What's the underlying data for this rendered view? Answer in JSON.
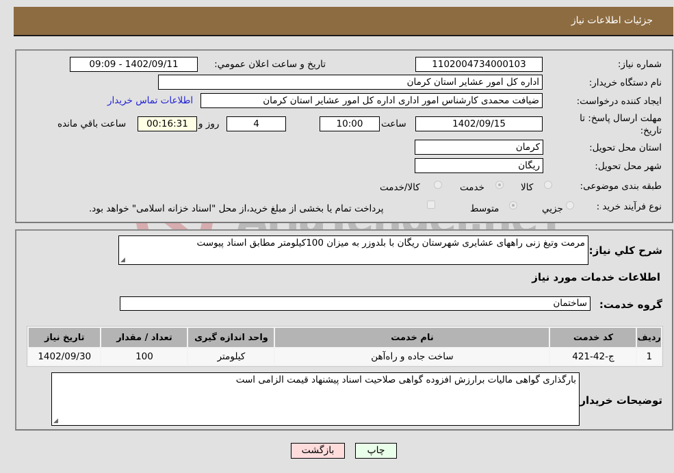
{
  "header": {
    "title": "جزئيات اطلاعات نياز"
  },
  "details": {
    "need_number_label": "شماره نياز:",
    "need_number": "1102004734000103",
    "announce_label": "تاريخ و ساعت اعلان عمومي:",
    "announce_value": "1402/09/11 - 09:09",
    "buyer_org_label": "نام دستگاه خريدار:",
    "buyer_org": "اداره کل امور عشاير استان کرمان",
    "creator_label": "ايجاد کننده درخواست:",
    "creator": "ضيافت محمدی کارشناس امور اداری اداره کل امور عشاير استان کرمان",
    "contact_link": "اطلاعات تماس خريدار",
    "deadline_label": "مهلت ارسال پاسخ: تا تاريخ:",
    "deadline_date": "1402/09/15",
    "time_label": "ساعت",
    "deadline_time": "10:00",
    "days_value": "4",
    "days_label": "روز و",
    "remaining_time": "00:16:31",
    "remaining_label": "ساعت باقي مانده",
    "province_label": "استان محل تحويل:",
    "province": "کرمان",
    "city_label": "شهر محل تحويل:",
    "city": "ريگان",
    "category_label": "طبقه بندی موضوعی:",
    "category_options": [
      {
        "label": "کالا",
        "selected": false
      },
      {
        "label": "خدمت",
        "selected": true
      },
      {
        "label": "کالا/خدمت",
        "selected": false
      }
    ],
    "process_label": "نوع فرآيند خريد :",
    "process_options": [
      {
        "label": "جزيي",
        "selected": false
      },
      {
        "label": "متوسط",
        "selected": true
      }
    ],
    "treasury_checkbox_checked": false,
    "treasury_note": "پرداخت تمام يا بخشی از مبلغ خريد،از محل \"اسناد خزانه اسلامی\" خواهد بود."
  },
  "description": {
    "label": "شرح کلي نياز:",
    "value": "مرمت وتيغ زنی راههای عشايری شهرستان ريگان با بلدوزر  به ميزان 100کيلومتر مطابق اسناد پيوست"
  },
  "services": {
    "section_title": "اطلاعات خدمات مورد نياز",
    "group_label": "گروه خدمت:",
    "group_value": "ساختمان",
    "table": {
      "headers": [
        "رديف",
        "کد خدمت",
        "نام خدمت",
        "واحد اندازه گيری",
        "تعداد / مقدار",
        "تاريخ نياز"
      ],
      "rows": [
        [
          "1",
          "ج-42-421",
          "ساخت جاده و راه‌آهن",
          "کيلومتر",
          "100",
          "1402/09/30"
        ]
      ]
    }
  },
  "buyer_notes": {
    "label": "توضيحات خريدار:",
    "value": "بارگذاری گواهی ماليات برارزش افزوده گواهی صلاحيت اسناد پيشنهاد قيمت  الزامی است"
  },
  "buttons": {
    "print": "چاپ",
    "back": "بازگشت"
  },
  "watermark": {
    "text": "AriaTender.neT"
  },
  "colors": {
    "header_bg": "#8d6c41",
    "print_btn_bg": "#eaffea",
    "back_btn_bg": "#ffdcdc",
    "link": "#1f1fd6"
  }
}
